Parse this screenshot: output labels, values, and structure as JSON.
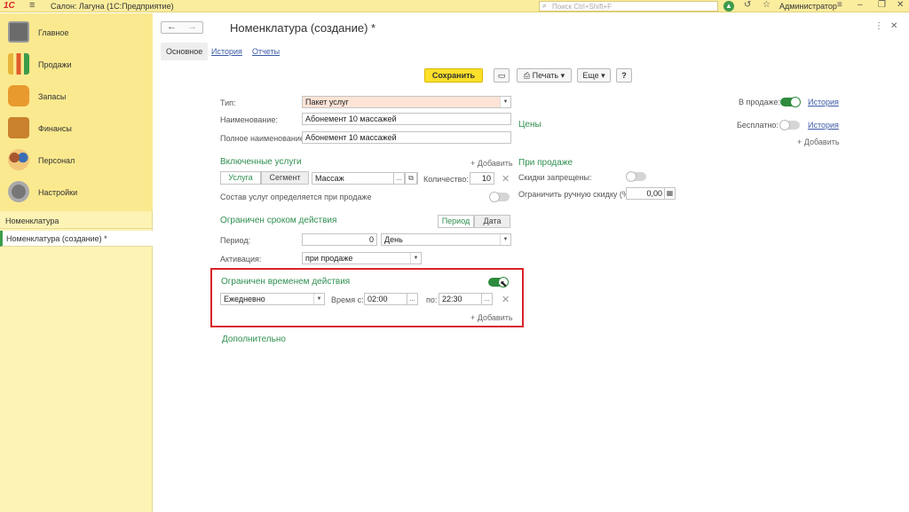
{
  "app": {
    "logo": "1С",
    "title": "Салон: Лагуна  (1С:Предприятие)",
    "search_placeholder": "Поиск Ctrl+Shift+F",
    "user": "Администратор"
  },
  "nav": [
    {
      "label": "Главное",
      "icon": "main-icon"
    },
    {
      "label": "Продажи",
      "icon": "sales-icon"
    },
    {
      "label": "Запасы",
      "icon": "stock-icon"
    },
    {
      "label": "Финансы",
      "icon": "finance-icon"
    },
    {
      "label": "Персонал",
      "icon": "staff-icon"
    },
    {
      "label": "Настройки",
      "icon": "settings-icon"
    }
  ],
  "opened_windows": [
    {
      "label": "Номенклатура"
    },
    {
      "label": "Номенклатура (создание) *"
    }
  ],
  "form": {
    "title": "Номенклатура (создание) *",
    "tabs": [
      "Основное",
      "История",
      "Отчеты"
    ],
    "toolbar": {
      "save": "Сохранить",
      "print": "Печать",
      "more": "Еще",
      "help": "?"
    },
    "fields": {
      "type_label": "Тип:",
      "type_value": "Пакет услуг",
      "name_label": "Наименование:",
      "name_value": "Абонемент 10 массажей",
      "fullname_label": "Полное наименование:",
      "fullname_value": "Абонемент 10 массажей"
    },
    "included": {
      "title": "Включенные услуги",
      "add": "+ Добавить",
      "seg_service": "Услуга",
      "seg_segment": "Сегмент",
      "service_value": "Массаж",
      "qty_label": "Количество:",
      "qty_value": "10",
      "composition_label": "Состав услуг определяется при продаже"
    },
    "limit_period": {
      "title": "Ограничен сроком действия",
      "seg_period": "Период",
      "seg_date": "Дата",
      "period_label": "Период:",
      "period_value": "0",
      "period_unit": "День",
      "activation_label": "Активация:",
      "activation_value": "при продаже"
    },
    "limit_time": {
      "title": "Ограничен временем действия",
      "freq_value": "Ежедневно",
      "from_label": "Время с:",
      "from_value": "02:00",
      "to_label": "по:",
      "to_value": "22:30",
      "add": "+ Добавить"
    },
    "additional_title": "Дополнительно",
    "right": {
      "on_sale_label": "В продаже:",
      "history": "История",
      "prices_title": "Цены",
      "free_label": "Бесплатно:",
      "add": "+ Добавить",
      "at_sale_title": "При продаже",
      "discounts_forbidden": "Скидки запрещены:",
      "limit_discount_label": "Ограничить ручную скидку (%):",
      "limit_discount_value": "0,00"
    }
  },
  "colors": {
    "accent_green": "#2f8f50",
    "toggle_green": "#2e8b3e",
    "save_yellow": "#fde02a",
    "panel_yellow": "#fbe98f",
    "highlight_red": "#d9232a"
  }
}
